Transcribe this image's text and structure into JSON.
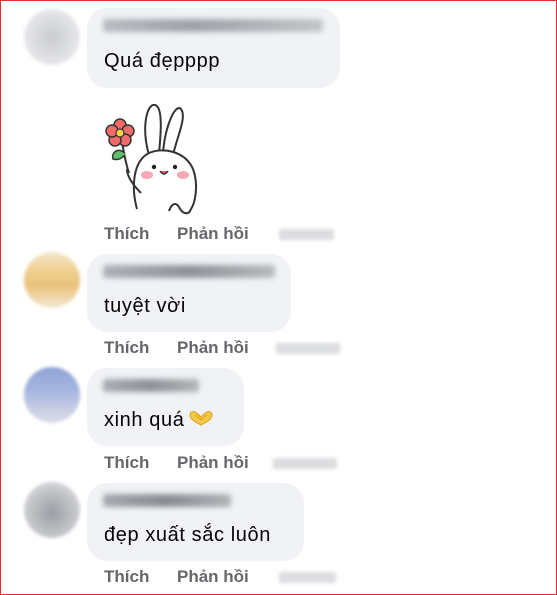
{
  "comments": [
    {
      "text": "Quá đẹpppp",
      "like_label": "Thích",
      "reply_label": "Phản hồi",
      "has_sticker": true,
      "sticker": "bunny-with-flower"
    },
    {
      "text": "tuyệt vời",
      "like_label": "Thích",
      "reply_label": "Phản hồi"
    },
    {
      "text": "xinh quá",
      "emoji": "heart-hands-icon",
      "like_label": "Thích",
      "reply_label": "Phản hồi"
    },
    {
      "text": "đẹp xuất sắc luôn",
      "like_label": "Thích",
      "reply_label": "Phản hồi"
    }
  ],
  "colors": {
    "bubble": "#f0f2f5",
    "action_text": "#65676b",
    "body_text": "#050505",
    "border": "#e0312b"
  }
}
